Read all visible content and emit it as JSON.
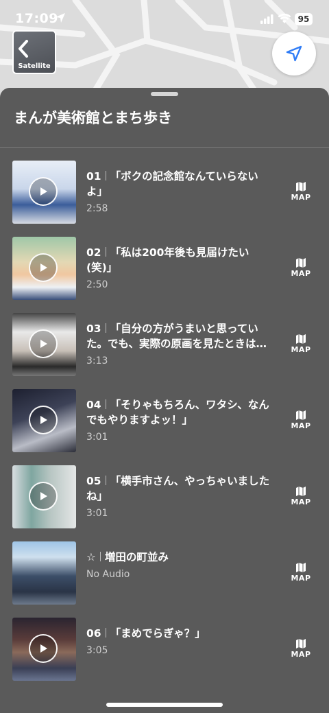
{
  "status_bar": {
    "time": "17:09",
    "battery": "95"
  },
  "map_controls": {
    "satellite_label": "Satellite"
  },
  "sheet": {
    "title": "まんが美術館とまち歩き",
    "items": [
      {
        "number": "01",
        "title": "「ボクの記念館なんていらないよ」",
        "subtitle": "2:58",
        "has_audio": true,
        "map_label": "MAP"
      },
      {
        "number": "02",
        "title": "「私は200年後も見届けたい(笑)」",
        "subtitle": "2:50",
        "has_audio": true,
        "map_label": "MAP"
      },
      {
        "number": "03",
        "title": "「自分の方がうまいと思っていた。でも、実際の原画を見たときは…",
        "subtitle": "3:13",
        "has_audio": true,
        "map_label": "MAP"
      },
      {
        "number": "04",
        "title": "「そりゃもちろん、ワタシ、なんでもやりますよッ！」",
        "subtitle": "3:01",
        "has_audio": true,
        "map_label": "MAP"
      },
      {
        "number": "05",
        "title": "「横手市さん、やっちゃいましたね」",
        "subtitle": "3:01",
        "has_audio": true,
        "map_label": "MAP"
      },
      {
        "number": "☆",
        "title": "増田の町並み",
        "subtitle": "No Audio",
        "has_audio": false,
        "map_label": "MAP"
      },
      {
        "number": "06",
        "title": "「まめでらぎゃ？」",
        "subtitle": "3:05",
        "has_audio": true,
        "map_label": "MAP"
      }
    ]
  },
  "colors": {
    "sheet_bg": "#5a5a5a",
    "accent_blue": "#2f7cf6"
  }
}
